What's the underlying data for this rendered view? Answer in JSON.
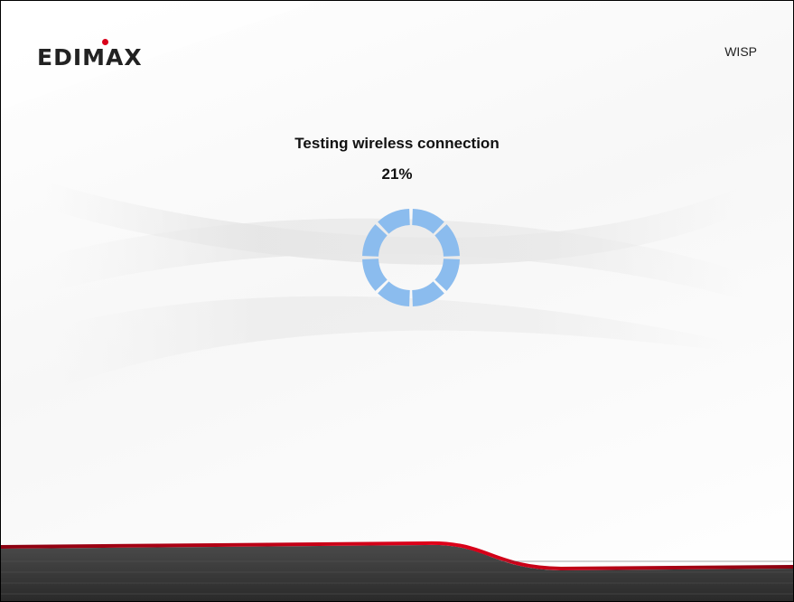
{
  "header": {
    "logo_text": "EDIMAX",
    "mode": "WISP"
  },
  "status": {
    "message": "Testing wireless connection",
    "progress": "21%"
  },
  "spinner": {
    "segments": 8,
    "color": "#8bbcee"
  },
  "colors": {
    "brand_red": "#d9001a",
    "footer_dark": "#3a3a3a"
  }
}
